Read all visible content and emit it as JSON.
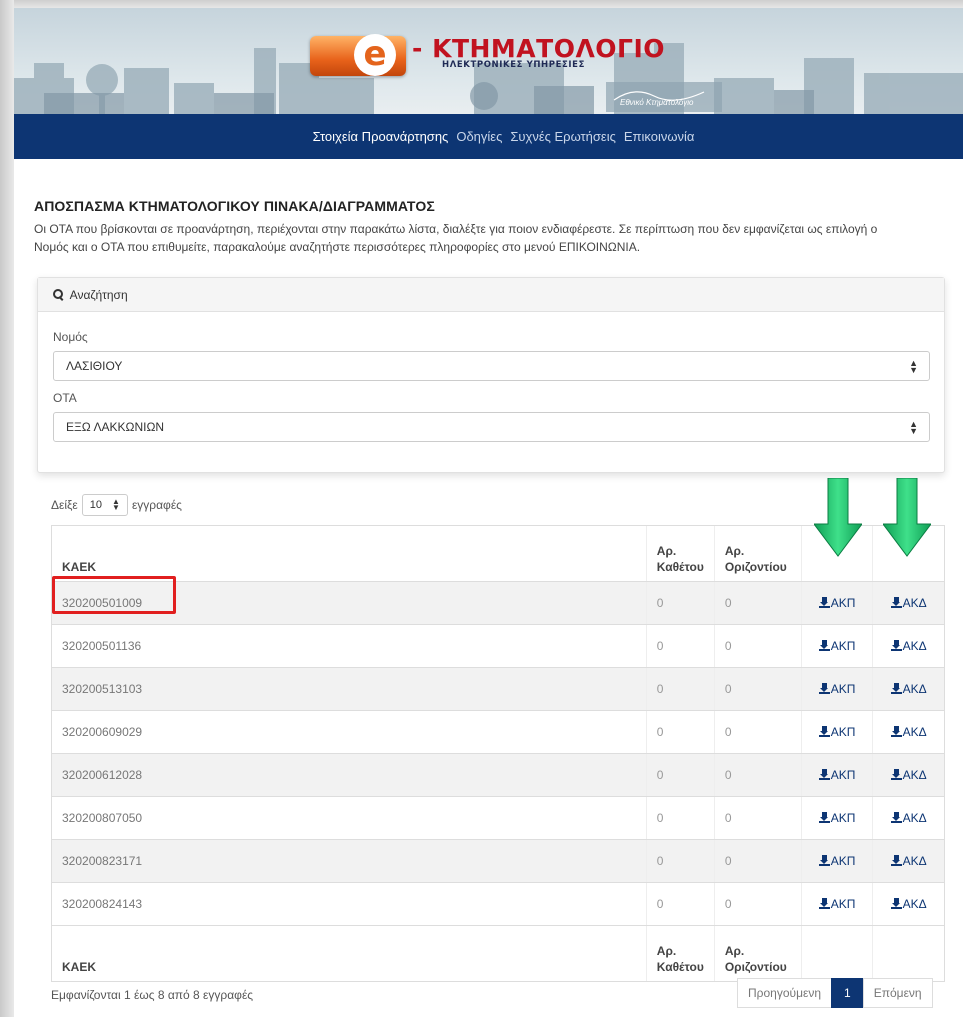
{
  "header": {
    "logo_letter": "e",
    "logo_title": "- ΚΤΗΜΑΤΟΛΟΓΙΟ",
    "logo_subtitle": "ΗΛΕΚΤΡΟΝΙΚΕΣ ΥΠΗΡΕΣΙΕΣ",
    "logo_small": "Εθνικό Κτηματολόγιο"
  },
  "nav": {
    "items": [
      {
        "label": "Στοιχεία Προανάρτησης",
        "active": true
      },
      {
        "label": "Οδηγίες",
        "active": false
      },
      {
        "label": "Συχνές Ερωτήσεις",
        "active": false
      },
      {
        "label": "Επικοινωνία",
        "active": false
      }
    ]
  },
  "main": {
    "heading": "ΑΠΟΣΠΑΣΜΑ ΚΤΗΜΑΤΟΛΟΓΙΚΟΥ ΠΙΝΑΚΑ/ΔΙΑΓΡΑΜΜΑΤΟΣ",
    "intro": "Οι ΟΤΑ που βρίσκονται σε προανάρτηση, περιέχονται στην παρακάτω λίστα, διαλέξτε για ποιον ενδιαφέρεστε. Σε περίπτωση που δεν εμφανίζεται ως επιλογή ο Νομός και ο ΟΤΑ που επιθυμείτε, παρακαλούμε αναζητήστε περισσότερες πληροφορίες στο μενού ΕΠΙΚΟΙΝΩΝΙΑ."
  },
  "search_panel": {
    "title": "Αναζήτηση",
    "nomos_label": "Νομός",
    "nomos_value": "ΛΑΣΙΘΙΟΥ",
    "ota_label": "ΟΤΑ",
    "ota_value": "ΕΞΩ ΛΑΚΚΩΝΙΩΝ"
  },
  "length": {
    "prefix": "Δείξε",
    "value": "10",
    "suffix": "εγγραφές"
  },
  "table": {
    "headers": {
      "kaek": "ΚΑΕΚ",
      "kathetou_1": "Αρ.",
      "kathetou_2": "Καθέτου",
      "orizontiou_1": "Αρ.",
      "orizontiou_2": "Οριζοντίου"
    },
    "rows": [
      {
        "kaek": "320200501009",
        "kathetou": "0",
        "orizontiou": "0",
        "akp": "ΑΚΠ",
        "akd": "ΑΚΔ"
      },
      {
        "kaek": "320200501136",
        "kathetou": "0",
        "orizontiou": "0",
        "akp": "ΑΚΠ",
        "akd": "ΑΚΔ"
      },
      {
        "kaek": "320200513103",
        "kathetou": "0",
        "orizontiou": "0",
        "akp": "ΑΚΠ",
        "akd": "ΑΚΔ"
      },
      {
        "kaek": "320200609029",
        "kathetou": "0",
        "orizontiou": "0",
        "akp": "ΑΚΠ",
        "akd": "ΑΚΔ"
      },
      {
        "kaek": "320200612028",
        "kathetou": "0",
        "orizontiou": "0",
        "akp": "ΑΚΠ",
        "akd": "ΑΚΔ"
      },
      {
        "kaek": "320200807050",
        "kathetou": "0",
        "orizontiou": "0",
        "akp": "ΑΚΠ",
        "akd": "ΑΚΔ"
      },
      {
        "kaek": "320200823171",
        "kathetou": "0",
        "orizontiou": "0",
        "akp": "ΑΚΠ",
        "akd": "ΑΚΔ"
      },
      {
        "kaek": "320200824143",
        "kathetou": "0",
        "orizontiou": "0",
        "akp": "ΑΚΠ",
        "akd": "ΑΚΔ"
      }
    ]
  },
  "footer": {
    "info": "Εμφανίζονται 1 έως 8 από 8 εγγραφές",
    "prev": "Προηγούμενη",
    "current_page": "1",
    "next": "Επόμενη"
  },
  "colors": {
    "navbar": "#0d3573",
    "highlight_box": "#e11f1f",
    "arrow": "#1fc46a"
  }
}
